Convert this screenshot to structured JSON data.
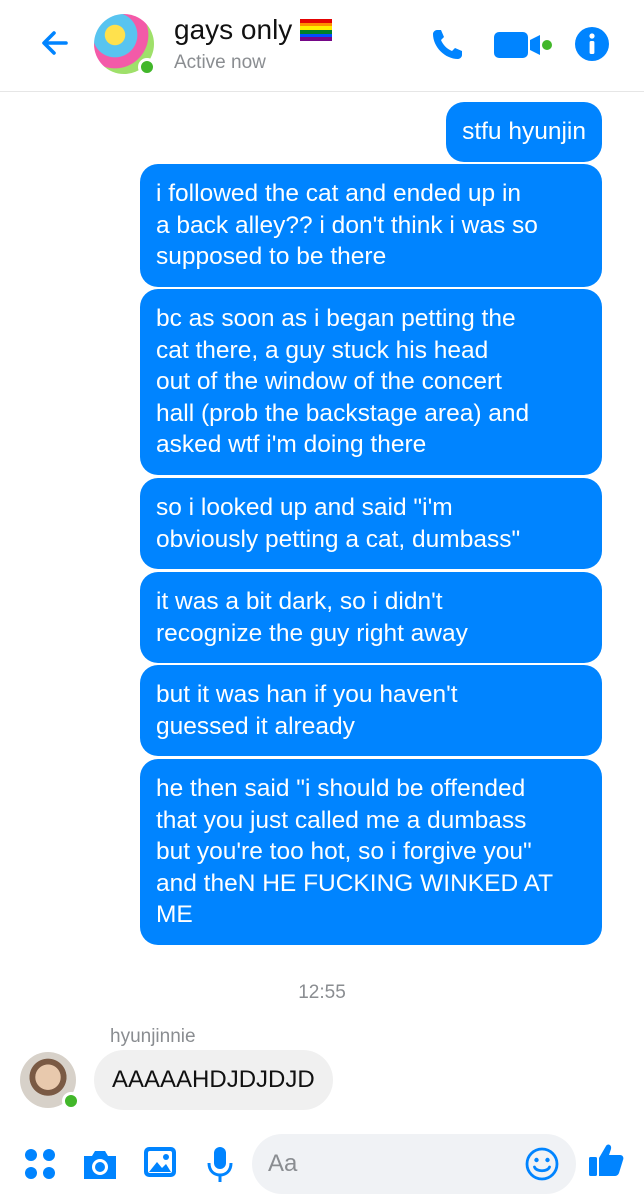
{
  "header": {
    "title": "gays only",
    "status": "Active now",
    "icons": [
      "back-arrow-icon",
      "phone-icon",
      "video-camera-icon",
      "info-icon"
    ],
    "accent_color": "#0084ff",
    "online_color": "#42b72a"
  },
  "messages": {
    "outgoing": [
      "stfu hyunjin",
      "i followed the cat and ended up in\na back alley?? i don't think i was so\nsupposed to be there",
      "bc as soon as i began petting the\ncat there, a guy stuck his head\nout of the window of the concert\nhall (prob the backstage area) and\nasked wtf i'm doing there",
      "so i looked up and said \"i'm\nobviously petting a cat, dumbass\"",
      "it was a bit dark, so i didn't\nrecognize the guy right away",
      "but it was han if you haven't\nguessed it already",
      "he then said \"i should be offended\nthat you just called me a dumbass\nbut you're too hot, so i forgive you\"\nand theN HE FUCKING WINKED AT\nME"
    ],
    "timestamp": "12:55",
    "incoming": {
      "sender": "hyunjinnie",
      "text": "AAAAAHDJDJDJD"
    }
  },
  "composer": {
    "placeholder": "Aa",
    "icons": [
      "apps-icon",
      "camera-icon",
      "image-icon",
      "microphone-icon",
      "emoji-icon",
      "thumbs-up-icon"
    ]
  }
}
